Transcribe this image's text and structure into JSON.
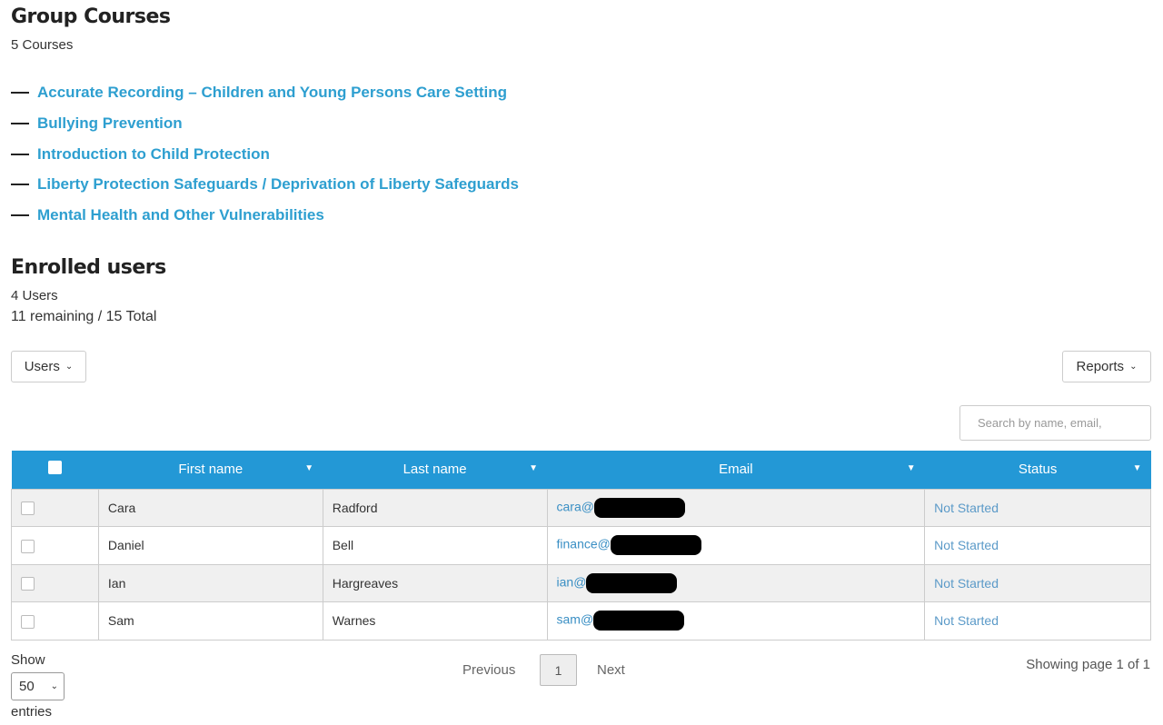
{
  "courses": {
    "title": "Group Courses",
    "count": "5 Courses",
    "items": [
      "Accurate Recording – Children and Young Persons Care Setting",
      "Bullying Prevention",
      "Introduction to Child Protection",
      "Liberty Protection Safeguards / Deprivation of Liberty Safeguards",
      "Mental Health and Other Vulnerabilities"
    ]
  },
  "enrolled": {
    "title": "Enrolled users",
    "count": "4 Users",
    "remaining": "11 remaining / 15 Total"
  },
  "toolbar": {
    "users_label": "Users",
    "reports_label": "Reports",
    "search_placeholder": "Search by name, email,"
  },
  "table": {
    "headers": [
      "First name",
      "Last name",
      "Email",
      "Status"
    ],
    "rows": [
      {
        "first": "Cara",
        "last": "Radford",
        "email": "cara@",
        "status": "Not Started"
      },
      {
        "first": "Daniel",
        "last": "Bell",
        "email": "finance@",
        "status": "Not Started"
      },
      {
        "first": "Ian",
        "last": "Hargreaves",
        "email": "ian@",
        "status": "Not Started"
      },
      {
        "first": "Sam",
        "last": "Warnes",
        "email": "sam@",
        "status": "Not Started"
      }
    ]
  },
  "footer": {
    "show": "Show",
    "entries_value": "50",
    "entries": "entries",
    "previous": "Previous",
    "page": "1",
    "next": "Next",
    "showing": "Showing page 1 of 1"
  },
  "colors": {
    "accent": "#2398d6",
    "link": "#2e9fd0"
  }
}
